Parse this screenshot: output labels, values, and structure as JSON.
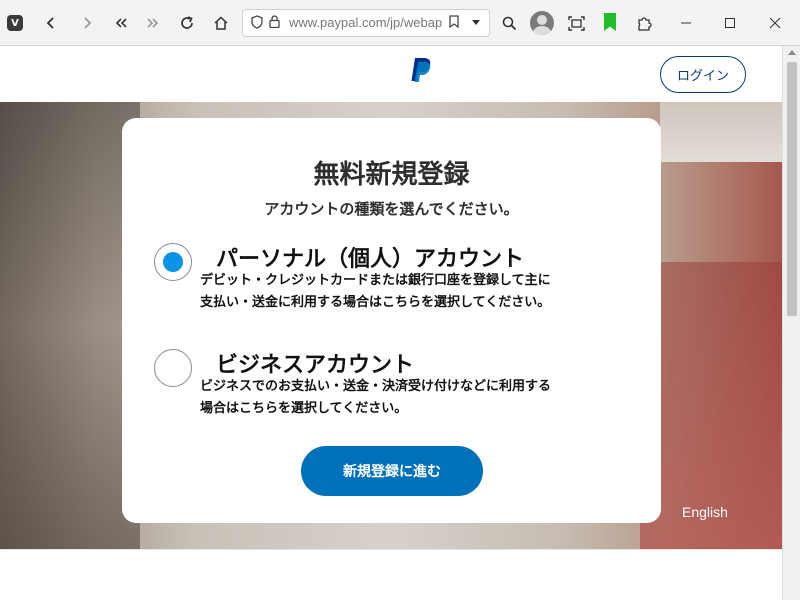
{
  "browser": {
    "url": "www.paypal.com/jp/webap"
  },
  "header": {
    "login_label": "ログイン"
  },
  "card": {
    "title": "無料新規登録",
    "subtitle": "アカウントの種類を選んでください。",
    "options": [
      {
        "title": "パーソナル（個人）アカウント",
        "desc_line1": "デビット・クレジットカードまたは銀行口座を登録して主に",
        "desc_line2": "支払い・送金に利用する場合はこちらを選択してください。",
        "selected": true
      },
      {
        "title": "ビジネスアカウント",
        "desc_line1": "ビジネスでのお支払い・送金・決済受け付けなどに利用する",
        "desc_line2": "場合はこちらを選択してください。",
        "selected": false
      }
    ],
    "cta_label": "新規登録に進む"
  },
  "footer": {
    "language_label": "English"
  },
  "colors": {
    "accent": "#0070ba",
    "radio_selected": "#0a94e6",
    "login_border": "#0a3a78"
  }
}
